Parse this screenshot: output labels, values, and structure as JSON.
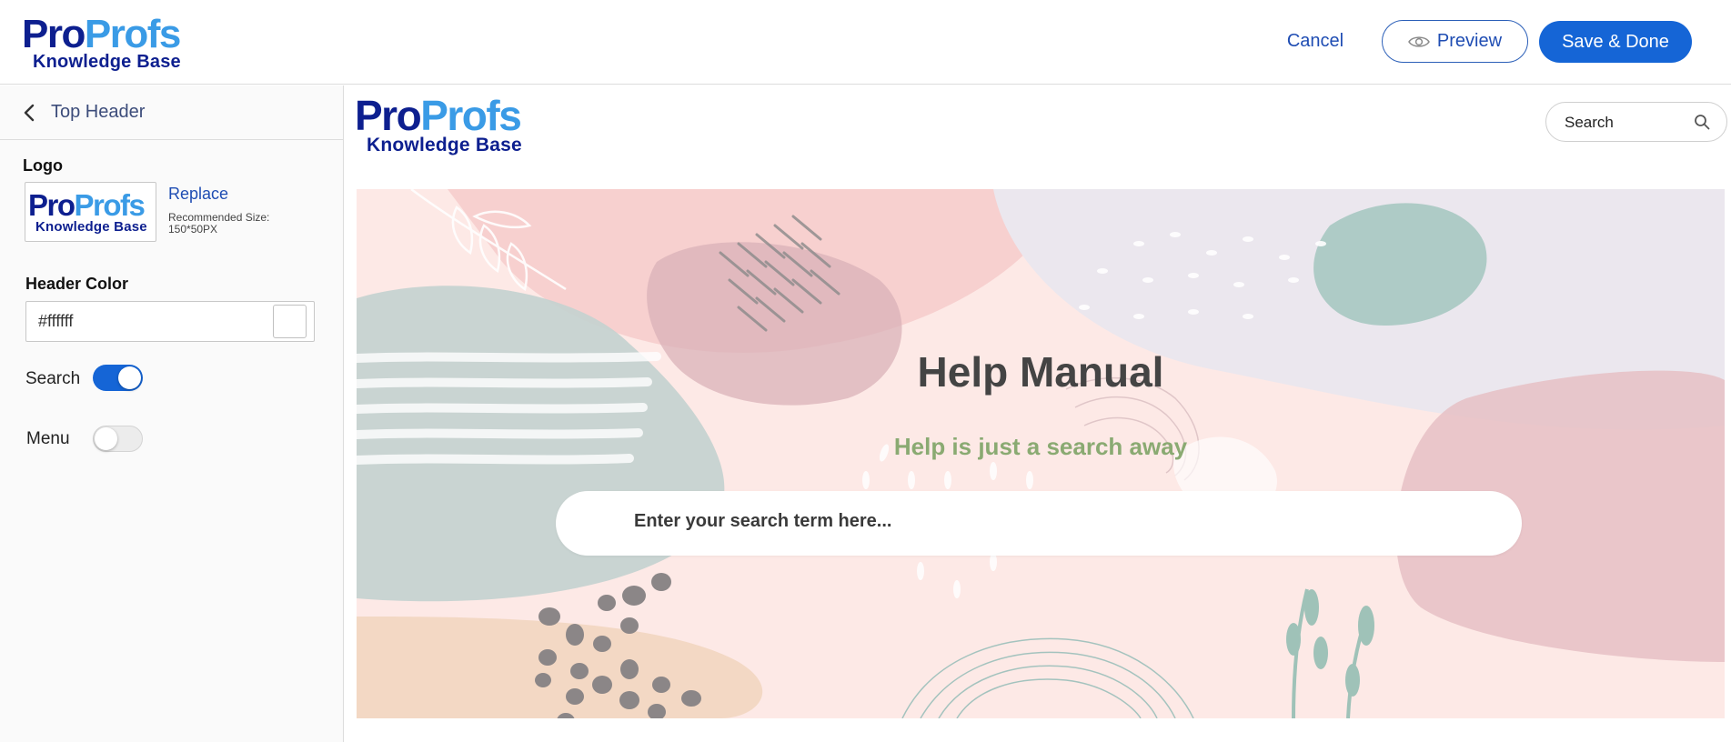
{
  "brand": {
    "logo_pro": "Pro",
    "logo_profs": "Profs",
    "logo_sub": "Knowledge Base"
  },
  "toolbar": {
    "cancel_label": "Cancel",
    "preview_label": "Preview",
    "save_label": "Save & Done"
  },
  "sidebar": {
    "back_label": "Top Header",
    "logo_section": "Logo",
    "replace_label": "Replace",
    "recommended_size": "Recommended Size: 150*50PX",
    "header_color_label": "Header Color",
    "header_color_value": "#ffffff",
    "search_label": "Search",
    "search_enabled": true,
    "menu_label": "Menu",
    "menu_enabled": false
  },
  "preview": {
    "search_placeholder": "Search",
    "hero_title": "Help Manual",
    "hero_subtitle": "Help is just a search away",
    "hero_search_placeholder": "Enter your search term here..."
  },
  "colors": {
    "accent": "#1565d6",
    "link": "#1f4db3",
    "logo_dark": "#0d1f8f",
    "logo_light": "#3a9be6",
    "subtitle": "#8aaa72"
  },
  "icons": {
    "back": "chevron-left-icon",
    "preview": "eye-icon",
    "search": "search-icon"
  }
}
